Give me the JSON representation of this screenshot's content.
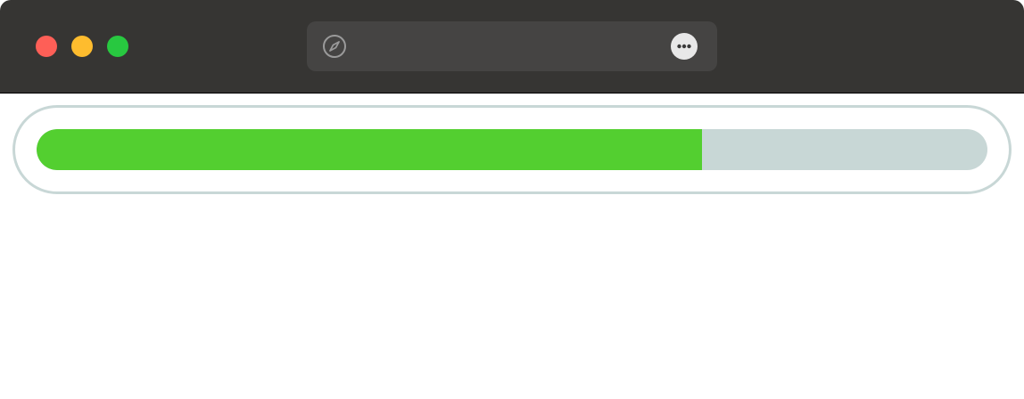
{
  "window": {
    "controls": {
      "close_color": "#fe5f57",
      "minimize_color": "#febc2e",
      "zoom_color": "#28c840"
    }
  },
  "addressbar": {
    "url": "",
    "left_icon": "compass-icon",
    "right_icon": "more-icon"
  },
  "progress": {
    "value": 0.7,
    "fill_color": "#53cf30",
    "track_color": "#c8d7d6"
  }
}
